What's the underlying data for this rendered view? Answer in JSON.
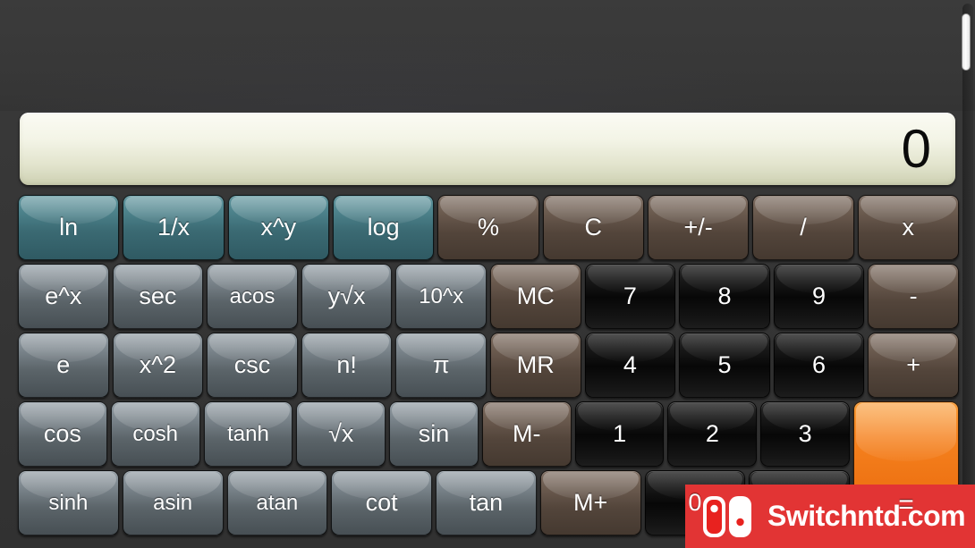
{
  "display": {
    "value": "0"
  },
  "keypad": {
    "rows": [
      {
        "id": "row-functions-1",
        "keys": [
          {
            "label": "ln",
            "style": "teal"
          },
          {
            "label": "1/x",
            "style": "teal"
          },
          {
            "label": "x^y",
            "style": "teal"
          },
          {
            "label": "log",
            "style": "teal"
          },
          {
            "label": "%",
            "style": "brown"
          },
          {
            "label": "C",
            "style": "brown"
          },
          {
            "label": "+/-",
            "style": "brown"
          },
          {
            "label": "/",
            "style": "brown"
          },
          {
            "label": "x",
            "style": "brown"
          }
        ]
      },
      {
        "id": "row-functions-2",
        "keys": [
          {
            "label": "e^x",
            "style": "gray"
          },
          {
            "label": "sec",
            "style": "gray"
          },
          {
            "label": "acos",
            "style": "gray"
          },
          {
            "label": "y√x",
            "style": "gray"
          },
          {
            "label": "10^x",
            "style": "gray"
          },
          {
            "label": "MC",
            "style": "brown"
          },
          {
            "label": "7",
            "style": "dark"
          },
          {
            "label": "8",
            "style": "dark"
          },
          {
            "label": "9",
            "style": "dark"
          },
          {
            "label": "-",
            "style": "brown"
          }
        ]
      },
      {
        "id": "row-functions-3",
        "keys": [
          {
            "label": "e",
            "style": "gray"
          },
          {
            "label": "x^2",
            "style": "gray"
          },
          {
            "label": "csc",
            "style": "gray"
          },
          {
            "label": "n!",
            "style": "gray"
          },
          {
            "label": "π",
            "style": "gray"
          },
          {
            "label": "MR",
            "style": "brown"
          },
          {
            "label": "4",
            "style": "dark"
          },
          {
            "label": "5",
            "style": "dark"
          },
          {
            "label": "6",
            "style": "dark"
          },
          {
            "label": "+",
            "style": "brown"
          }
        ]
      },
      {
        "id": "row-functions-4",
        "keys": [
          {
            "label": "cos",
            "style": "gray"
          },
          {
            "label": "cosh",
            "style": "gray"
          },
          {
            "label": "tanh",
            "style": "gray"
          },
          {
            "label": "√x",
            "style": "gray"
          },
          {
            "label": "sin",
            "style": "gray"
          },
          {
            "label": "M-",
            "style": "brown"
          },
          {
            "label": "1",
            "style": "dark"
          },
          {
            "label": "2",
            "style": "dark"
          },
          {
            "label": "3",
            "style": "dark"
          }
        ]
      },
      {
        "id": "row-functions-5",
        "keys": [
          {
            "label": "sinh",
            "style": "gray"
          },
          {
            "label": "asin",
            "style": "gray"
          },
          {
            "label": "atan",
            "style": "gray"
          },
          {
            "label": "cot",
            "style": "gray"
          },
          {
            "label": "tan",
            "style": "gray"
          },
          {
            "label": "M+",
            "style": "brown"
          },
          {
            "label": "0",
            "style": "dark"
          },
          {
            "label": "",
            "style": "dark"
          }
        ]
      }
    ],
    "equals_label": "="
  },
  "watermark": {
    "text": "Switchntd.com",
    "background_color": "#e23434",
    "logo_name": "switch-console-icon"
  },
  "colors": {
    "background": "#373737",
    "display_background": "#f3f4e6",
    "key_teal": "#4b8089",
    "key_brown": "#6a5a4e",
    "key_gray": "#7b858c",
    "key_dark": "#0a0a0a",
    "key_orange": "#f5821f"
  }
}
